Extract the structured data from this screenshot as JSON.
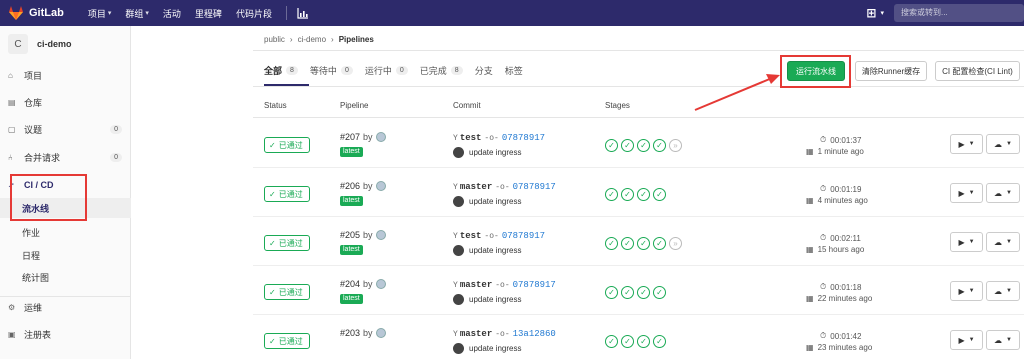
{
  "nav": {
    "logo_text": "GitLab",
    "items": [
      "项目",
      "群组",
      "活动",
      "里程碑",
      "代码片段"
    ],
    "search_placeholder": "搜索或转到..."
  },
  "sidebar": {
    "avatar_letter": "C",
    "project_name": "ci-demo",
    "items": [
      {
        "label": "项目",
        "icon": "home-icon"
      },
      {
        "label": "仓库",
        "icon": "book-icon"
      },
      {
        "label": "议题",
        "icon": "issues-icon",
        "count": "0"
      },
      {
        "label": "合并请求",
        "icon": "merge-request-icon",
        "count": "0"
      },
      {
        "label": "CI / CD",
        "icon": "rocket-icon"
      },
      {
        "label": "流水线"
      },
      {
        "label": "作业"
      },
      {
        "label": "日程"
      },
      {
        "label": "统计图"
      },
      {
        "label": "运维",
        "icon": "operations-icon"
      },
      {
        "label": "注册表",
        "icon": "registry-icon"
      }
    ]
  },
  "breadcrumb": [
    "public",
    "ci-demo",
    "Pipelines"
  ],
  "tabs": [
    {
      "label": "全部",
      "count": "8"
    },
    {
      "label": "等待中",
      "count": "0"
    },
    {
      "label": "运行中",
      "count": "0"
    },
    {
      "label": "已完成",
      "count": "8"
    },
    {
      "label": "分支"
    },
    {
      "label": "标签"
    }
  ],
  "buttons": {
    "run_pipeline": "运行流水线",
    "clear_cache": "清除Runner缓存",
    "ci_lint": "CI 配置检查(CI Lint)"
  },
  "columns": [
    "Status",
    "Pipeline",
    "Commit",
    "Stages"
  ],
  "pipelines": [
    {
      "status": "已通过",
      "id": "#207",
      "by": "by",
      "latest": "latest",
      "ref": "test",
      "sha": "07878917",
      "message": "update ingress",
      "stages": [
        "passed",
        "passed",
        "passed",
        "passed",
        "skipped"
      ],
      "duration": "00:01:37",
      "ago": "1 minute ago"
    },
    {
      "status": "已通过",
      "id": "#206",
      "by": "by",
      "latest": "latest",
      "ref": "master",
      "sha": "07878917",
      "message": "update ingress",
      "stages": [
        "passed",
        "passed",
        "passed",
        "passed"
      ],
      "duration": "00:01:19",
      "ago": "4 minutes ago"
    },
    {
      "status": "已通过",
      "id": "#205",
      "by": "by",
      "latest": "latest",
      "ref": "test",
      "sha": "07878917",
      "message": "update ingress",
      "stages": [
        "passed",
        "passed",
        "passed",
        "passed",
        "skipped"
      ],
      "duration": "00:02:11",
      "ago": "15 hours ago"
    },
    {
      "status": "已通过",
      "id": "#204",
      "by": "by",
      "latest": "latest",
      "ref": "master",
      "sha": "07878917",
      "message": "update ingress",
      "stages": [
        "passed",
        "passed",
        "passed",
        "passed"
      ],
      "duration": "00:01:18",
      "ago": "22 minutes ago"
    },
    {
      "status": "已通过",
      "id": "#203",
      "by": "by",
      "latest": "",
      "ref": "master",
      "sha": "13a12860",
      "message": "update ingress",
      "stages": [
        "passed",
        "passed",
        "passed",
        "passed"
      ],
      "duration": "00:01:42",
      "ago": "23 minutes ago"
    }
  ],
  "colors": {
    "nav": "#2d2a6b",
    "success": "#1aaa55",
    "annotation": "#e53935",
    "link": "#1f78d1"
  }
}
